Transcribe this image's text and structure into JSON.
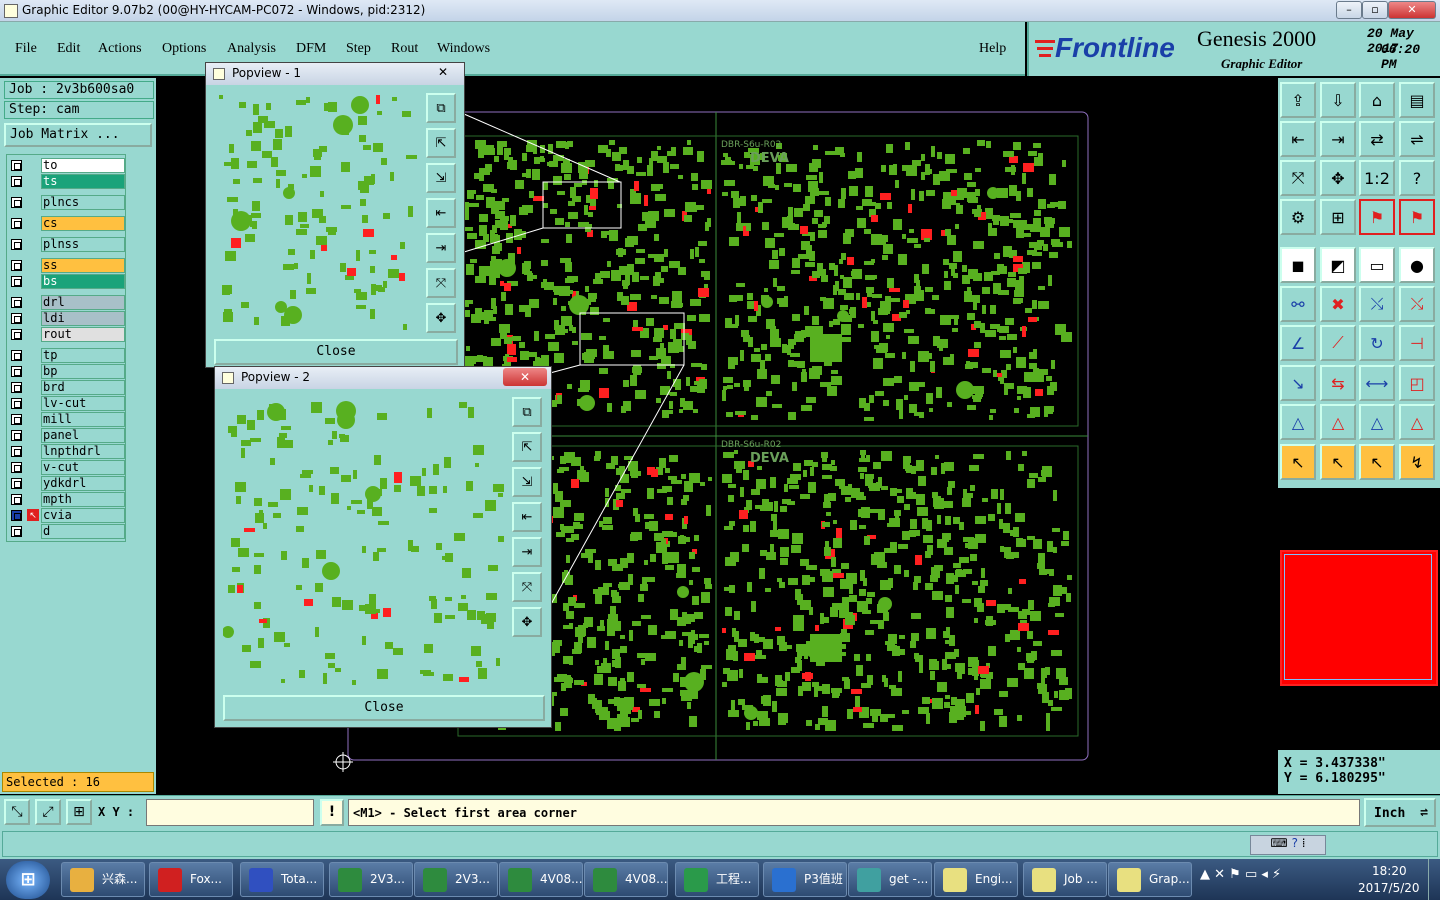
{
  "window": {
    "title": "Graphic Editor 9.07b2 (00@HY-HYCAM-PC072 - Windows, pid:2312)",
    "min": "–",
    "max": "▫",
    "close": "✕"
  },
  "menu": [
    "File",
    "Edit",
    "Actions",
    "Options",
    "Analysis",
    "DFM",
    "Step",
    "Rout",
    "Windows"
  ],
  "help": "Help",
  "logo": {
    "brand": "Frontline",
    "product": "Genesis 2000",
    "subtitle": "Graphic Editor",
    "date": "20 May 2017",
    "time": "06:20 PM"
  },
  "job": {
    "job_label": "Job : 2v3b600sa0",
    "step_label": "Step: cam",
    "matrix": "Job Matrix ..."
  },
  "layers": [
    {
      "name": "to",
      "color": "#ffffff"
    },
    {
      "name": "ts",
      "color": "#1aa37a"
    },
    {
      "name": "plncs",
      "color": "#98d8d0"
    },
    {
      "name": "cs",
      "color": "#ffc040"
    },
    {
      "name": "plnss",
      "color": "#98d8d0"
    },
    {
      "name": "ss",
      "color": "#ffc040"
    },
    {
      "name": "bs",
      "color": "#1aa37a"
    },
    {
      "name": "drl",
      "color": "#a8c0c8"
    },
    {
      "name": "ldi",
      "color": "#a8c0c8"
    },
    {
      "name": "rout",
      "color": "#e0e0e0"
    },
    {
      "name": "tp",
      "color": "#98d8d0"
    },
    {
      "name": "bp",
      "color": "#98d8d0"
    },
    {
      "name": "brd",
      "color": "#98d8d0"
    },
    {
      "name": "lv-cut",
      "color": "#98d8d0"
    },
    {
      "name": "mill",
      "color": "#98d8d0"
    },
    {
      "name": "panel",
      "color": "#98d8d0"
    },
    {
      "name": "lnpthdrl",
      "color": "#98d8d0"
    },
    {
      "name": "v-cut",
      "color": "#98d8d0"
    },
    {
      "name": "ydkdrl",
      "color": "#98d8d0"
    },
    {
      "name": "mpth",
      "color": "#98d8d0"
    },
    {
      "name": "cvia",
      "color": "#98d8d0"
    },
    {
      "name": "d",
      "color": "#98d8d0"
    }
  ],
  "selected": "Selected : 16",
  "board": {
    "label1": "DBR-S6u-R02",
    "label2": "DEVA"
  },
  "popup1": {
    "title": "Popview - 1",
    "close": "Close"
  },
  "popup2": {
    "title": "Popview - 2",
    "close": "Close"
  },
  "coords": {
    "x": "X = 3.437338\"",
    "y": "Y = 6.180295\""
  },
  "xy_label": "X Y :",
  "xy_value": "",
  "prompt": "<M1> - Select first area corner",
  "units": "Inch",
  "taskbar": [
    {
      "label": "兴森...",
      "icon": "#e8b040"
    },
    {
      "label": "Fox...",
      "icon": "#d02020"
    },
    {
      "label": "Tota...",
      "icon": "#3050c0"
    },
    {
      "label": "2V3...",
      "icon": "#2e8b3e"
    },
    {
      "label": "2V3...",
      "icon": "#2e8b3e"
    },
    {
      "label": "4V08...",
      "icon": "#2e8b3e"
    },
    {
      "label": "4V08...",
      "icon": "#2e8b3e"
    },
    {
      "label": "工程...",
      "icon": "#2a9a4a"
    },
    {
      "label": "P3值班",
      "icon": "#2a70d0"
    },
    {
      "label": "get -...",
      "icon": "#40a0a0"
    },
    {
      "label": "Engi...",
      "icon": "#e8e080"
    },
    {
      "label": "Job ...",
      "icon": "#e8e080"
    },
    {
      "label": "Grap...",
      "icon": "#e8e080"
    }
  ],
  "clock": {
    "time": "18:20",
    "date": "2017/5/20"
  }
}
